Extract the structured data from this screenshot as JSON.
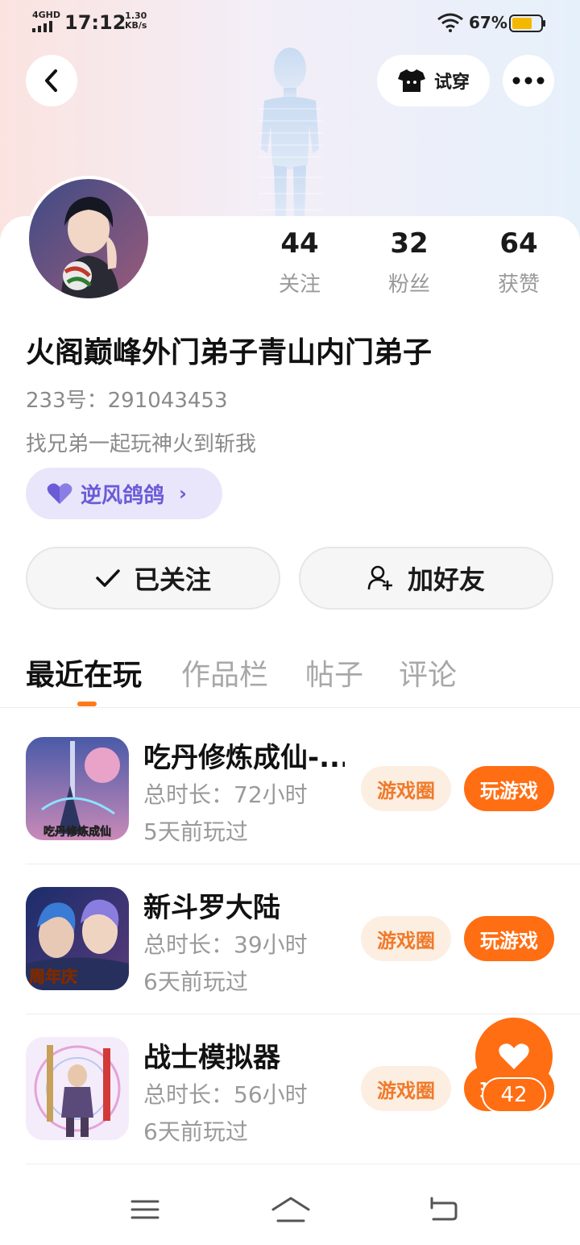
{
  "status_bar": {
    "network": "4GHD",
    "time": "17:12",
    "speed_value": "1.30",
    "speed_unit": "KB/s",
    "battery": "67%"
  },
  "header": {
    "tryon_label": "试穿"
  },
  "profile": {
    "stats": [
      {
        "value": "44",
        "label": "关注"
      },
      {
        "value": "32",
        "label": "粉丝"
      },
      {
        "value": "64",
        "label": "获赞"
      }
    ],
    "nickname": "火阁巅峰外门弟子青山内门弟子",
    "uid": "233号：291043453",
    "signature": "找兄弟一起玩神火到斩我",
    "guild": "逆风鸽鸽"
  },
  "actions": {
    "followed_label": "已关注",
    "add_friend_label": "加好友"
  },
  "tabs": [
    {
      "label": "最近在玩"
    },
    {
      "label": "作品栏"
    },
    {
      "label": "帖子"
    },
    {
      "label": "评论"
    }
  ],
  "games": [
    {
      "title": "吃丹修炼成仙-...",
      "duration": "总时长：72小时",
      "last_played": "5天前玩过",
      "icon_caption": "吃丹修炼成仙",
      "circle_label": "游戏圈",
      "play_label": "玩游戏"
    },
    {
      "title": "新斗罗大陆",
      "duration": "总时长：39小时",
      "last_played": "6天前玩过",
      "icon_caption": "周年庆",
      "circle_label": "游戏圈",
      "play_label": "玩游戏"
    },
    {
      "title": "战士模拟器",
      "duration": "总时长：56小时",
      "last_played": "6天前玩过",
      "icon_caption": "",
      "circle_label": "游戏圈",
      "play_label": "玩游戏"
    }
  ],
  "like_fab": {
    "count": "42"
  },
  "colors": {
    "accent": "#ff6e12",
    "guild_text": "#6b5bd6",
    "guild_bg": "#e9e6fb"
  }
}
